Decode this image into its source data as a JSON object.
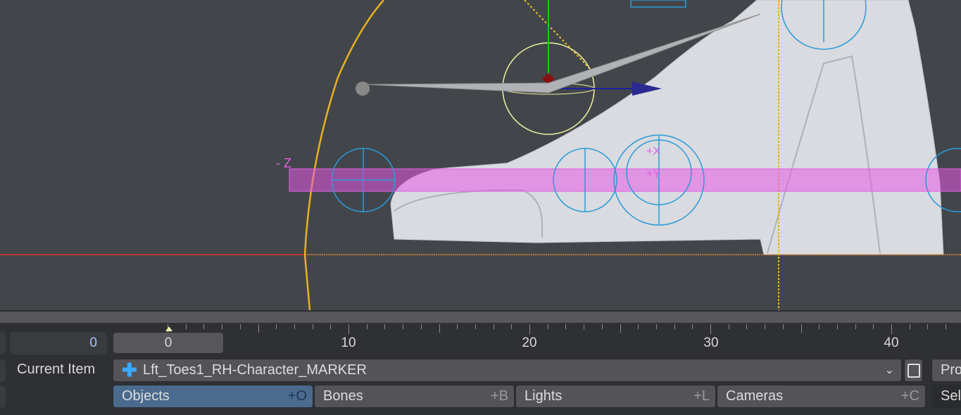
{
  "viewport": {
    "axis_label": "- Z",
    "handle_labels": [
      "+X",
      "+Y"
    ]
  },
  "colors": {
    "accent": "#4a6a8e",
    "frame_text": "#9fc3ff",
    "marker": "#e35fe3",
    "bone": "#2a9bd8"
  },
  "frame_field": {
    "value": "0"
  },
  "timeline": {
    "current_frame": "0",
    "tick_labels": [
      "10",
      "20",
      "30",
      "40"
    ]
  },
  "current_item": {
    "label": "Current Item",
    "value": "Lft_Toes1_RH-Character_MARKER",
    "icon": "null-object-icon"
  },
  "right_panel": {
    "properties_label": "Pro",
    "select_label": "Sel"
  },
  "item_types": [
    {
      "label": "Objects",
      "shortcut": "+O",
      "selected": true
    },
    {
      "label": "Bones",
      "shortcut": "+B",
      "selected": false
    },
    {
      "label": "Lights",
      "shortcut": "+L",
      "selected": false
    },
    {
      "label": "Cameras",
      "shortcut": "+C",
      "selected": false
    }
  ]
}
